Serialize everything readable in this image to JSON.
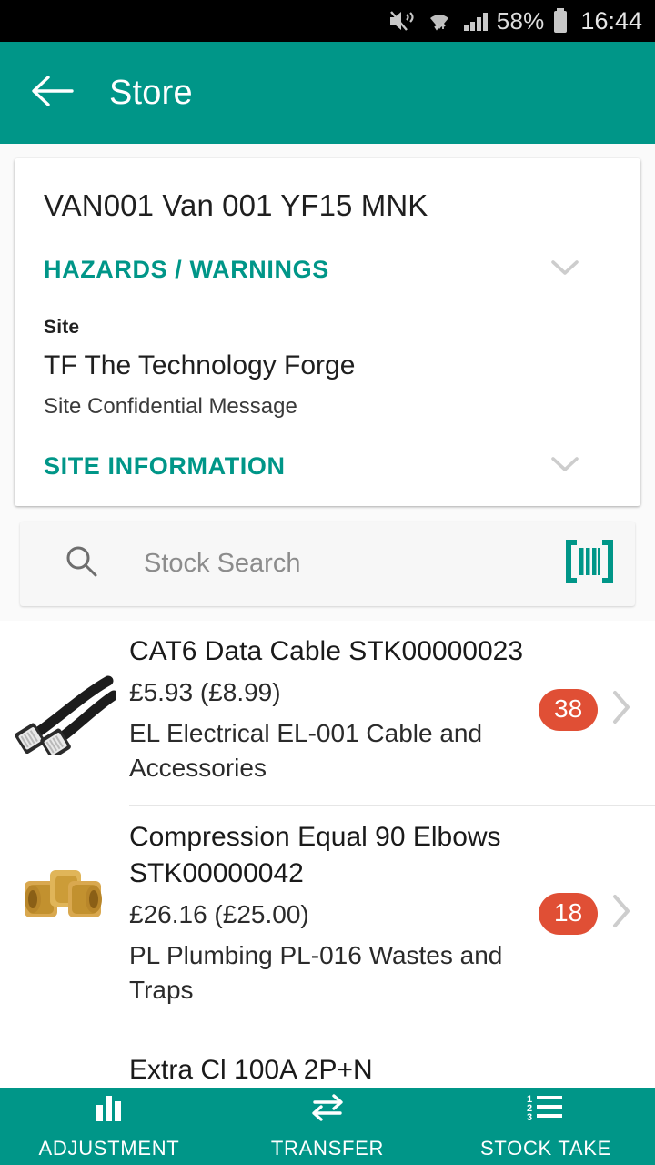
{
  "statusbar": {
    "battery_percent": "58%",
    "time": "16:44",
    "icons": [
      "volume-mute-icon",
      "wifi-icon",
      "cellular-signal-icon",
      "battery-icon"
    ]
  },
  "appbar": {
    "back_icon": "back-arrow-icon",
    "title": "Store"
  },
  "info_card": {
    "asset_title": "VAN001 Van 001 YF15 MNK",
    "hazards_label": "HAZARDS / WARNINGS",
    "site_label": "Site",
    "site_name": "TF The Technology Forge",
    "site_message": "Site Confidential Message",
    "site_information_label": "SITE INFORMATION",
    "expand_icon": "chevron-down-icon"
  },
  "search": {
    "placeholder": "Stock Search",
    "value": "",
    "search_icon": "search-icon",
    "barcode_icon": "barcode-scan-icon"
  },
  "stock_items": [
    {
      "title": "CAT6 Data Cable STK00000023",
      "price": "£5.93 (£8.99)",
      "category": "EL Electrical EL-001 Cable and Accessories",
      "quantity": "38",
      "thumbnail": "ethernet-cable-image",
      "chevron_icon": "chevron-right-icon"
    },
    {
      "title": "Compression Equal 90 Elbows STK00000042",
      "price": "£26.16 (£25.00)",
      "category": "PL Plumbing PL-016 Wastes and Traps",
      "quantity": "18",
      "thumbnail": "brass-elbow-fitting-image",
      "chevron_icon": "chevron-right-icon"
    },
    {
      "title": "Extra Cl         100A 2P+N",
      "price": "",
      "category": "",
      "quantity": "",
      "thumbnail": "",
      "chevron_icon": ""
    }
  ],
  "bottom_nav": [
    {
      "label": "ADJUSTMENT",
      "icon": "bar-chart-icon"
    },
    {
      "label": "TRANSFER",
      "icon": "transfer-arrows-icon"
    },
    {
      "label": "STOCK TAKE",
      "icon": "numbered-list-icon"
    }
  ],
  "colors": {
    "accent_teal": "#009688",
    "badge_red": "#e04f35",
    "statusbar_black": "#000000",
    "card_white": "#ffffff"
  }
}
